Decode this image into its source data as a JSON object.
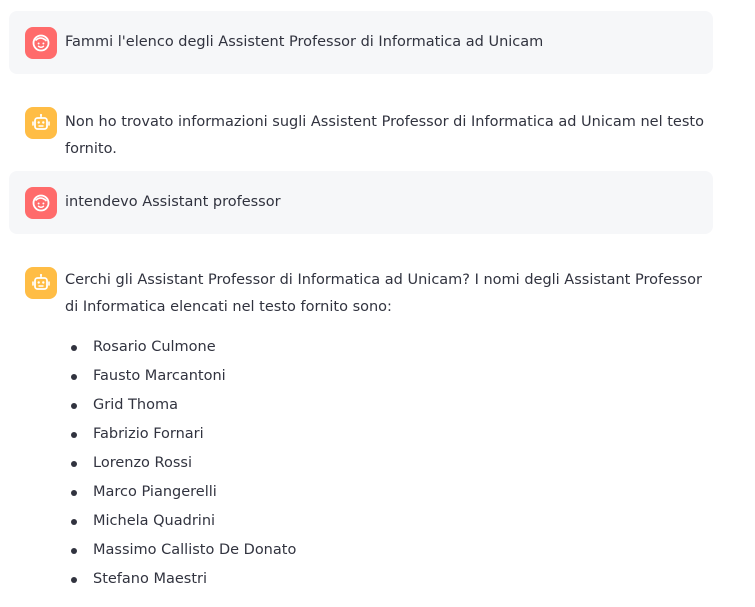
{
  "messages": [
    {
      "role": "user",
      "icon": "user-face-icon",
      "text": "Fammi l'elenco degli Assistent Professor di Informatica ad Unicam"
    },
    {
      "role": "assistant",
      "icon": "robot-icon",
      "text": "Non ho trovato informazioni sugli Assistent Professor di Informatica ad Unicam nel testo fornito."
    },
    {
      "role": "user",
      "icon": "user-face-icon",
      "text": "intendevo Assistant professor"
    },
    {
      "role": "assistant",
      "icon": "robot-icon",
      "text": "Cerchi gli Assistant Professor di Informatica ad Unicam? I nomi degli Assistant Professor di Informatica elencati nel testo fornito sono:",
      "list": [
        "Rosario Culmone",
        "Fausto Marcantoni",
        "Grid Thoma",
        "Fabrizio Fornari",
        "Lorenzo Rossi",
        "Marco Piangerelli",
        "Michela Quadrini",
        "Massimo Callisto De Donato",
        "Stefano Maestri"
      ]
    }
  ],
  "colors": {
    "user_avatar": "#ff6b6b",
    "assistant_avatar": "#ffbd45",
    "user_bubble": "#f6f7f9",
    "text": "#31333f"
  }
}
